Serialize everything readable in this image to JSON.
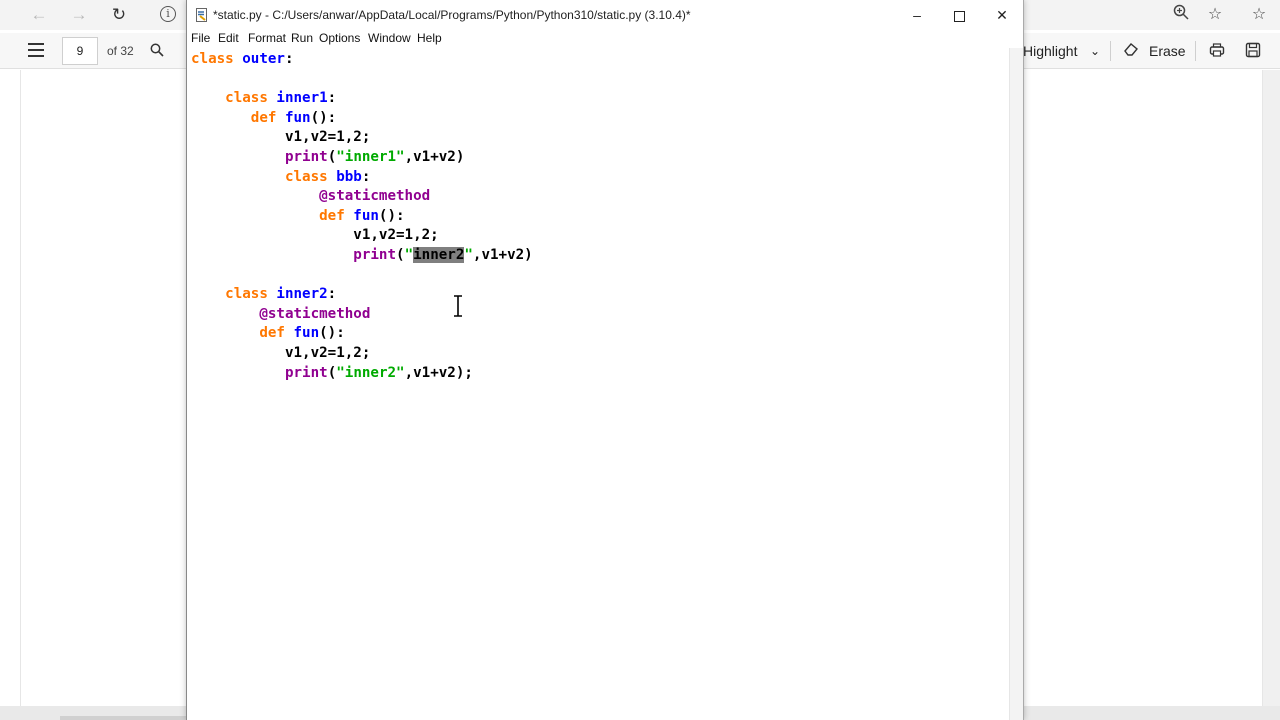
{
  "browser": {
    "nav_icons": [
      "back-arrow-icon",
      "forward-arrow-icon",
      "refresh-icon",
      "info-icon"
    ],
    "right_icons": [
      "zoom-icon",
      "favorites-icon",
      "star-icon"
    ]
  },
  "pdf_toolbar": {
    "page_number": "9",
    "page_total": "of 32",
    "highlight_label": "Highlight",
    "erase_label": "Erase"
  },
  "idle": {
    "title": "*static.py - C:/Users/anwar/AppData/Local/Programs/Python/Python310/static.py (3.10.4)*",
    "menu": [
      "File",
      "Edit",
      "Format",
      "Run",
      "Options",
      "Window",
      "Help"
    ],
    "code_lines": [
      [
        {
          "t": "class ",
          "c": "kw"
        },
        {
          "t": "outer",
          "c": "def"
        },
        {
          "t": ":",
          "c": ""
        }
      ],
      [],
      [
        {
          "t": "    class ",
          "c": "kw"
        },
        {
          "t": "inner1",
          "c": "def"
        },
        {
          "t": ":",
          "c": ""
        }
      ],
      [
        {
          "t": "       def ",
          "c": "kw"
        },
        {
          "t": "fun",
          "c": "def"
        },
        {
          "t": "():",
          "c": ""
        }
      ],
      [
        {
          "t": "           v1,v2=1,2;",
          "c": ""
        }
      ],
      [
        {
          "t": "           ",
          "c": ""
        },
        {
          "t": "print",
          "c": "bi"
        },
        {
          "t": "(",
          "c": ""
        },
        {
          "t": "\"inner1\"",
          "c": "str"
        },
        {
          "t": ",v1+v2)",
          "c": ""
        }
      ],
      [
        {
          "t": "           class ",
          "c": "kw"
        },
        {
          "t": "bbb",
          "c": "def"
        },
        {
          "t": ":",
          "c": ""
        }
      ],
      [
        {
          "t": "               @staticmethod",
          "c": "bi"
        }
      ],
      [
        {
          "t": "               def ",
          "c": "kw"
        },
        {
          "t": "fun",
          "c": "def"
        },
        {
          "t": "():",
          "c": ""
        }
      ],
      [
        {
          "t": "                   v1,v2=1,2;",
          "c": ""
        }
      ],
      [
        {
          "t": "                   ",
          "c": ""
        },
        {
          "t": "print",
          "c": "bi"
        },
        {
          "t": "(",
          "c": ""
        },
        {
          "t": "\"",
          "c": "str"
        },
        {
          "t": "inner2",
          "c": "sel"
        },
        {
          "t": "\"",
          "c": "str"
        },
        {
          "t": ",v1+v2)",
          "c": ""
        }
      ],
      [],
      [
        {
          "t": "    class ",
          "c": "kw"
        },
        {
          "t": "inner2",
          "c": "def"
        },
        {
          "t": ":",
          "c": ""
        }
      ],
      [
        {
          "t": "        @staticmethod",
          "c": "bi"
        }
      ],
      [
        {
          "t": "        def ",
          "c": "kw"
        },
        {
          "t": "fun",
          "c": "def"
        },
        {
          "t": "():",
          "c": ""
        }
      ],
      [
        {
          "t": "           v1,v2=1,2;",
          "c": ""
        }
      ],
      [
        {
          "t": "           ",
          "c": ""
        },
        {
          "t": "print",
          "c": "bi"
        },
        {
          "t": "(",
          "c": ""
        },
        {
          "t": "\"inner2\"",
          "c": "str"
        },
        {
          "t": ",v1+v2);",
          "c": ""
        }
      ]
    ]
  }
}
